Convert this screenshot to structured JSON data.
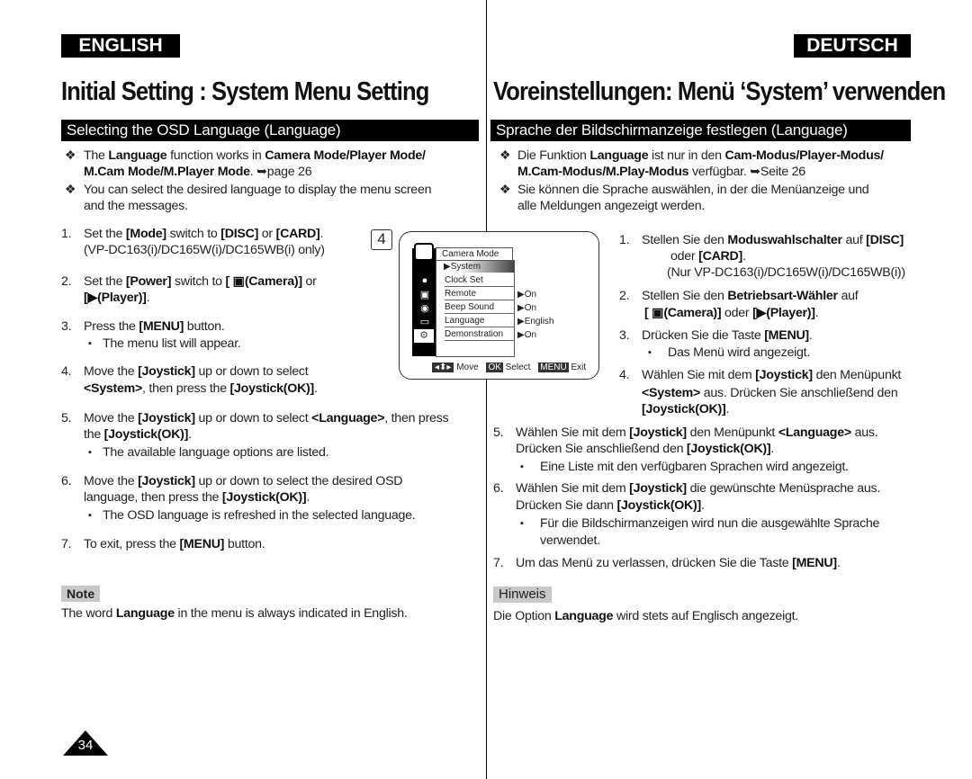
{
  "header": {
    "left_lang": "ENGLISH",
    "right_lang": "DEUTSCH",
    "left_title": "Initial Setting : System Menu Setting",
    "right_title": "Voreinstellungen: Menü ‘System’ verwenden",
    "left_section": "Selecting the OSD Language (Language)",
    "right_section": "Sprache der Bildschirmanzeige festlegen (Language)"
  },
  "english": {
    "lines": [
      [
        "The **Language** function works in **Camera Mode/Player Mode/**",
        "**M.Cam Mode/M.Player Mode**. ➥page 26"
      ],
      [
        "You can select the desired language to display the menu screen",
        "and the messages."
      ]
    ],
    "steps": [
      {
        "n": "1.",
        "lines": [
          "Set the **[Mode]** switch to **[DISC]** or **[CARD]**.",
          "(VP-DC163(i)/DC165W(i)/DC165WB(i) only)"
        ]
      },
      {
        "n": "2.",
        "lines": [
          "Set the **[Power]** switch to **[ ▣(Camera)]** or",
          "**[▶(Player)]**."
        ]
      },
      {
        "n": "3.",
        "lines": [
          "Press the **[MENU]** button."
        ],
        "sub": [
          "The menu list will appear."
        ]
      },
      {
        "n": "4.",
        "lines": [
          "Move the **[Joystick]** up or down to select",
          "**<System>**, then press the **[Joystick(OK)]**."
        ]
      },
      {
        "n": "5.",
        "lines": [
          "Move the **[Joystick]** up or down to select **<Language>**, then press",
          "the **[Joystick(OK)]**."
        ],
        "sub": [
          "The available language options are listed."
        ]
      },
      {
        "n": "6.",
        "lines": [
          "Move the **[Joystick]** up or down to select the desired OSD",
          "language, then press the **[Joystick(OK)]**."
        ],
        "sub": [
          "The OSD language is refreshed in the selected language."
        ]
      },
      {
        "n": "7.",
        "lines": [
          "To exit, press the **[MENU]** button."
        ]
      }
    ],
    "note_label": "Note",
    "note": "The word **Language** in the menu is always indicated in English."
  },
  "deutsch": {
    "lines": [
      [
        "Die Funktion **Language** ist nur in den **Cam-Modus/Player-Modus/**",
        "**M.Cam-Modus/M.Play-Modus** verfügbar. ➥Seite 26"
      ],
      [
        "Sie können die Sprache auswählen, in der die Menüanzeige und",
        "alle Meldungen angezeigt werden."
      ]
    ],
    "steps": [
      {
        "n": "1.",
        "lines": [
          "Stellen Sie den **Moduswahlschalter** auf **[DISC]**",
          "oder **[CARD]**.",
          "(Nur VP-DC163(i)/DC165W(i)/DC165WB(i))"
        ]
      },
      {
        "n": "2.",
        "lines": [
          "Stellen Sie den **Betriebsart-Wähler** auf",
          "**[ ▣(Camera)]** oder **[▶(Player)]**."
        ]
      },
      {
        "n": "3.",
        "lines": [
          "Drücken Sie die Taste **[MENU]**."
        ],
        "sub": [
          "Das Menü wird angezeigt."
        ]
      },
      {
        "n": "4.",
        "lines": [
          "Wählen Sie mit dem **[Joystick]** den Menüpunkt",
          "**<System>** aus. Drücken Sie anschließend den",
          "**[Joystick(OK)]**."
        ]
      },
      {
        "n": "5.",
        "lines": [
          "Wählen Sie mit dem **[Joystick]** den Menüpunkt **<Language>** aus.",
          "Drücken Sie anschließend den **[Joystick(OK)]**."
        ],
        "sub": [
          "Eine Liste mit den verfügbaren Sprachen wird angezeigt."
        ]
      },
      {
        "n": "6.",
        "lines": [
          "Wählen Sie mit dem **[Joystick]** die gewünschte Menüsprache aus.",
          "Drücken Sie dann **[Joystick(OK)]**."
        ],
        "sub": [
          "Für die Bildschirmanzeigen wird nun die ausgewählte Sprache",
          "verwendet."
        ]
      },
      {
        "n": "7.",
        "lines": [
          "Um das Menü zu verlassen, drücken Sie die Taste **[MENU]**."
        ]
      }
    ],
    "note_label": "Hinweis",
    "note": "Die Option **Language** wird stets auf Englisch angezeigt."
  },
  "screen": {
    "step": "4",
    "mode": "Camera Mode",
    "selected": "▶System",
    "items": [
      {
        "label": "Clock Set",
        "value": ""
      },
      {
        "label": "Remote",
        "value": "▶On"
      },
      {
        "label": "Beep Sound",
        "value": "▶On"
      },
      {
        "label": "Language",
        "value": "▶English"
      },
      {
        "label": "Demonstration",
        "value": "▶On"
      }
    ],
    "footer": {
      "move": "Move",
      "ok": "OK",
      "select": "Select",
      "menu": "MENU",
      "exit": "Exit"
    }
  },
  "page_number": "34"
}
